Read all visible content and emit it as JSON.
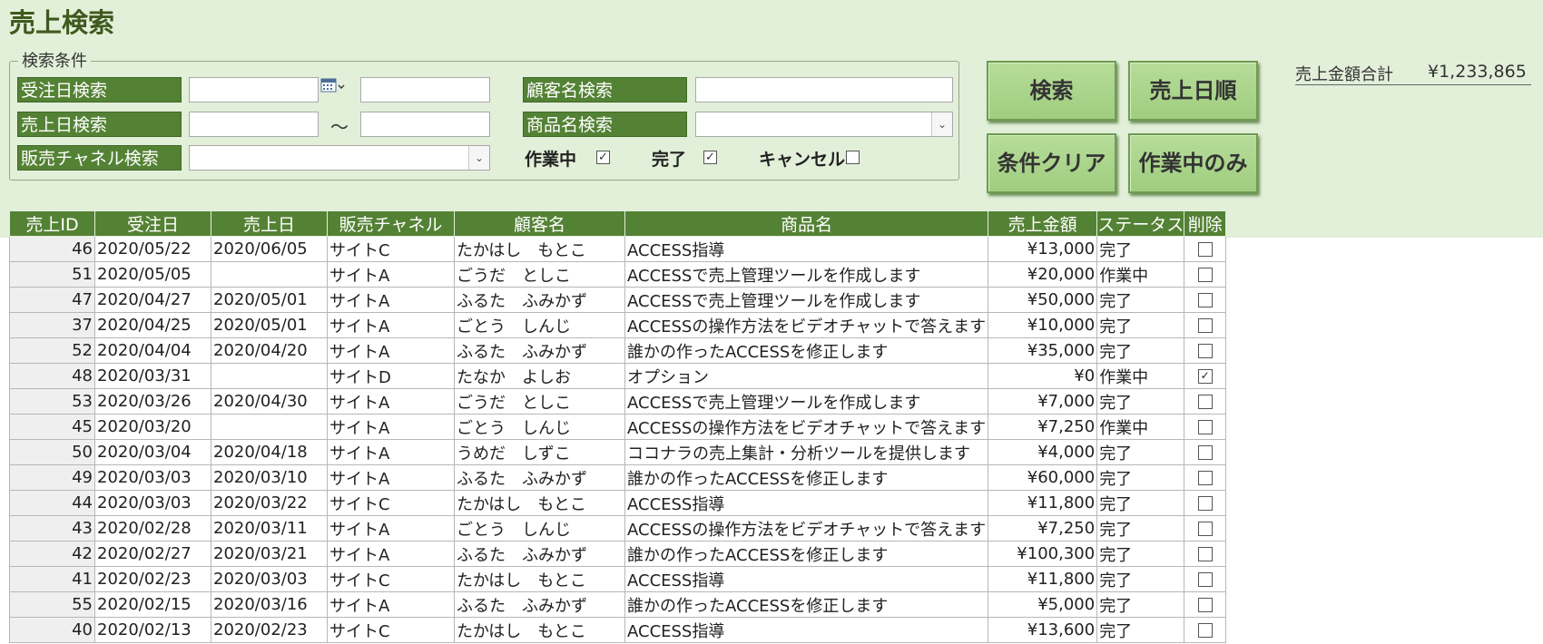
{
  "title": "売上検索",
  "search": {
    "legend": "検索条件",
    "order_date_label": "受注日検索",
    "sales_date_label": "売上日検索",
    "channel_label": "販売チャネル検索",
    "customer_label": "顧客名検索",
    "product_label": "商品名検索",
    "range_separator": "～",
    "status": {
      "in_progress_label": "作業中",
      "in_progress_checked": true,
      "done_label": "完了",
      "done_checked": true,
      "cancel_label": "キャンセル",
      "cancel_checked": false
    }
  },
  "buttons": {
    "search": "検索",
    "sort_sales_date": "売上日順",
    "clear": "条件クリア",
    "in_progress_only": "作業中のみ"
  },
  "total": {
    "label": "売上金額合計",
    "value": "¥1,233,865"
  },
  "table": {
    "columns": [
      "売上ID",
      "受注日",
      "売上日",
      "販売チャネル",
      "顧客名",
      "商品名",
      "売上金額",
      "ステータス",
      "削除"
    ],
    "rows": [
      {
        "id": "46",
        "order": "2020/05/22",
        "sale": "2020/06/05",
        "channel": "サイトC",
        "customer": "たかはし　もとこ",
        "product": "ACCESS指導",
        "amount": "¥13,000",
        "status": "完了",
        "deleted": false
      },
      {
        "id": "51",
        "order": "2020/05/05",
        "sale": "",
        "channel": "サイトA",
        "customer": "ごうだ　としこ",
        "product": "ACCESSで売上管理ツールを作成します",
        "amount": "¥20,000",
        "status": "作業中",
        "deleted": false
      },
      {
        "id": "47",
        "order": "2020/04/27",
        "sale": "2020/05/01",
        "channel": "サイトA",
        "customer": "ふるた　ふみかず",
        "product": "ACCESSで売上管理ツールを作成します",
        "amount": "¥50,000",
        "status": "完了",
        "deleted": false
      },
      {
        "id": "37",
        "order": "2020/04/25",
        "sale": "2020/05/01",
        "channel": "サイトA",
        "customer": "ごとう　しんじ",
        "product": "ACCESSの操作方法をビデオチャットで答えます",
        "amount": "¥10,000",
        "status": "完了",
        "deleted": false
      },
      {
        "id": "52",
        "order": "2020/04/04",
        "sale": "2020/04/20",
        "channel": "サイトA",
        "customer": "ふるた　ふみかず",
        "product": "誰かの作ったACCESSを修正します",
        "amount": "¥35,000",
        "status": "完了",
        "deleted": false
      },
      {
        "id": "48",
        "order": "2020/03/31",
        "sale": "",
        "channel": "サイトD",
        "customer": "たなか　よしお",
        "product": "オプション",
        "amount": "¥0",
        "status": "作業中",
        "deleted": true
      },
      {
        "id": "53",
        "order": "2020/03/26",
        "sale": "2020/04/30",
        "channel": "サイトA",
        "customer": "ごうだ　としこ",
        "product": "ACCESSで売上管理ツールを作成します",
        "amount": "¥7,000",
        "status": "完了",
        "deleted": false
      },
      {
        "id": "45",
        "order": "2020/03/20",
        "sale": "",
        "channel": "サイトA",
        "customer": "ごとう　しんじ",
        "product": "ACCESSの操作方法をビデオチャットで答えます",
        "amount": "¥7,250",
        "status": "作業中",
        "deleted": false
      },
      {
        "id": "50",
        "order": "2020/03/04",
        "sale": "2020/04/18",
        "channel": "サイトA",
        "customer": "うめだ　しずこ",
        "product": "ココナラの売上集計・分析ツールを提供します",
        "amount": "¥4,000",
        "status": "完了",
        "deleted": false
      },
      {
        "id": "49",
        "order": "2020/03/03",
        "sale": "2020/03/10",
        "channel": "サイトA",
        "customer": "ふるた　ふみかず",
        "product": "誰かの作ったACCESSを修正します",
        "amount": "¥60,000",
        "status": "完了",
        "deleted": false
      },
      {
        "id": "44",
        "order": "2020/03/03",
        "sale": "2020/03/22",
        "channel": "サイトC",
        "customer": "たかはし　もとこ",
        "product": "ACCESS指導",
        "amount": "¥11,800",
        "status": "完了",
        "deleted": false
      },
      {
        "id": "43",
        "order": "2020/02/28",
        "sale": "2020/03/11",
        "channel": "サイトA",
        "customer": "ごとう　しんじ",
        "product": "ACCESSの操作方法をビデオチャットで答えます",
        "amount": "¥7,250",
        "status": "完了",
        "deleted": false
      },
      {
        "id": "42",
        "order": "2020/02/27",
        "sale": "2020/03/21",
        "channel": "サイトA",
        "customer": "ふるた　ふみかず",
        "product": "誰かの作ったACCESSを修正します",
        "amount": "¥100,300",
        "status": "完了",
        "deleted": false
      },
      {
        "id": "41",
        "order": "2020/02/23",
        "sale": "2020/03/03",
        "channel": "サイトC",
        "customer": "たかはし　もとこ",
        "product": "ACCESS指導",
        "amount": "¥11,800",
        "status": "完了",
        "deleted": false
      },
      {
        "id": "55",
        "order": "2020/02/15",
        "sale": "2020/03/16",
        "channel": "サイトA",
        "customer": "ふるた　ふみかず",
        "product": "誰かの作ったACCESSを修正します",
        "amount": "¥5,000",
        "status": "完了",
        "deleted": false
      },
      {
        "id": "40",
        "order": "2020/02/13",
        "sale": "2020/02/23",
        "channel": "サイトC",
        "customer": "たかはし　もとこ",
        "product": "ACCESS指導",
        "amount": "¥13,600",
        "status": "完了",
        "deleted": false
      }
    ]
  },
  "colors": {
    "header_bg": "#e2efd9",
    "label_bg": "#548235",
    "button_bg": "#a9d18e"
  },
  "icons": {
    "calendar": "calendar-icon",
    "dropdown": "chevron-down-icon",
    "checkbox": "checkbox-icon"
  }
}
